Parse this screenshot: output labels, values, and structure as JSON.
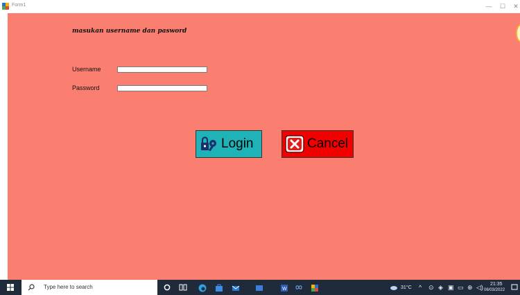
{
  "window": {
    "title": "Form1",
    "minimize_icon": "minimize-icon",
    "maximize_icon": "maximize-icon",
    "close_icon": "close-icon"
  },
  "form": {
    "heading": "masukan username dan pasword",
    "username_label": "Username",
    "username_value": "",
    "password_label": "Password",
    "password_value": "",
    "login_label": "Login",
    "cancel_label": "Cancel",
    "background_color": "#fa7f70",
    "login_color": "#1fb3b7",
    "cancel_color": "#f20000"
  },
  "taskbar": {
    "search_placeholder": "Type here to search",
    "weather": "31°C",
    "time": "21:35",
    "date": "06/03/2022",
    "pinned_icons": [
      "cortana-icon",
      "task-view-icon",
      "edge-icon",
      "store-icon",
      "mail-icon",
      "photos-icon",
      "word-icon",
      "infinity-icon",
      "app-icon"
    ]
  }
}
